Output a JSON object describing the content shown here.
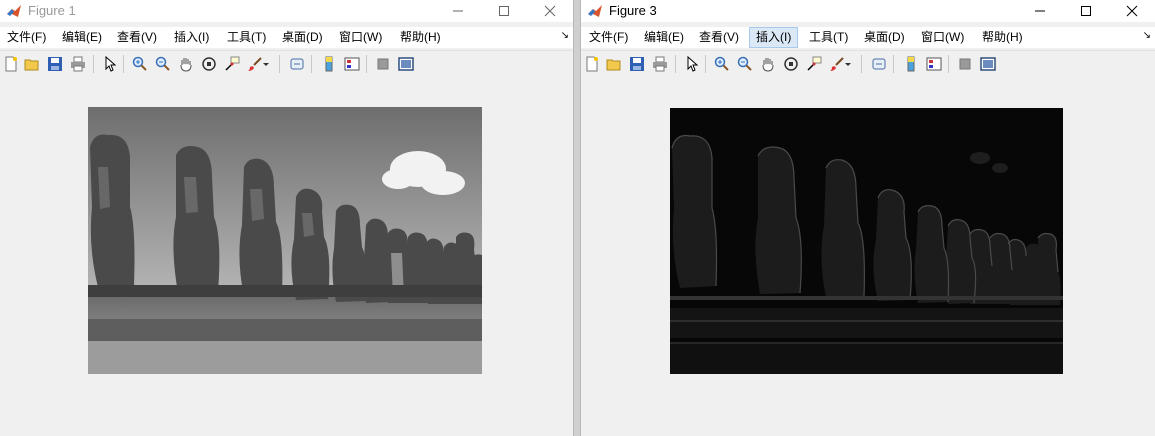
{
  "windows": [
    {
      "title": "Figure 1",
      "menu": [
        "文件(F)",
        "编辑(E)",
        "查看(V)",
        "插入(I)",
        "工具(T)",
        "桌面(D)",
        "窗口(W)",
        "帮助(H)"
      ]
    },
    {
      "title": "Figure 3",
      "menu": [
        "文件(F)",
        "编辑(E)",
        "查看(V)",
        "插入(I)",
        "工具(T)",
        "桌面(D)",
        "窗口(W)",
        "帮助(H)"
      ],
      "active_menu": "插入(I)"
    }
  ],
  "toolbar_icons": [
    "new-figure-icon",
    "open-file-icon",
    "save-icon",
    "print-icon",
    "edit-plot-arrow-icon",
    "zoom-in-icon",
    "zoom-out-icon",
    "pan-hand-icon",
    "rotate-3d-icon",
    "data-cursor-icon",
    "brush-icon",
    "link-plot-icon",
    "insert-colorbar-icon",
    "insert-legend-icon",
    "hide-plot-tools-icon",
    "show-plot-tools-icon"
  ],
  "images": [
    {
      "figure": "Figure 1",
      "content": "grayscale photo of Moai statues"
    },
    {
      "figure": "Figure 3",
      "content": "edge-filtered dark version of the same photo"
    }
  ]
}
